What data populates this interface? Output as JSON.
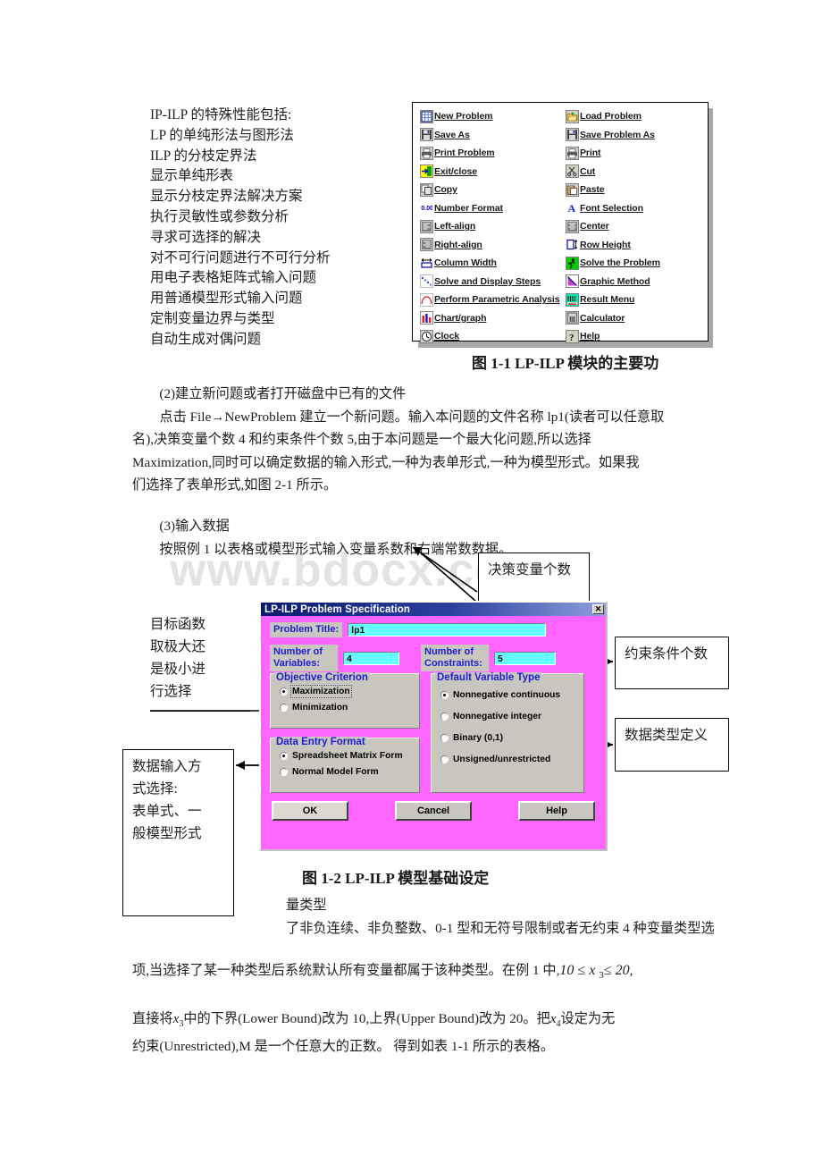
{
  "watermark": "www.bdocx.com",
  "feature_list": {
    "items": [
      "IP-ILP 的特殊性能包括:",
      "LP 的单纯形法与图形法",
      "ILP 的分枝定界法",
      "显示单纯形表",
      "显示分枝定界法解决方案",
      "执行灵敏性或参数分析",
      "寻求可选择的解决",
      "对不可行问题进行不可行分析",
      "用电子表格矩阵式输入问题",
      "用普通模型形式输入问题",
      "定制变量边界与类型",
      "自动生成对偶问题"
    ]
  },
  "toolbar": {
    "left_column": [
      {
        "icon": "new-problem-icon",
        "label": "New Problem"
      },
      {
        "icon": "save-icon",
        "label": "Save As"
      },
      {
        "icon": "printer-icon",
        "label": "Print Problem"
      },
      {
        "icon": "exit-door-icon",
        "label": "Exit/close"
      },
      {
        "icon": "copy-icon",
        "label": "Copy"
      },
      {
        "icon": "number-format-icon",
        "label": "Number Format"
      },
      {
        "icon": "left-align-icon",
        "label": "Left-align"
      },
      {
        "icon": "right-align-icon",
        "label": "Right-align"
      },
      {
        "icon": "column-width-icon",
        "label": "Column Width"
      },
      {
        "icon": "steps-icon",
        "label": "Solve and Display Steps"
      },
      {
        "icon": "parametric-curve-icon",
        "label": "Perform Parametric Analysis"
      },
      {
        "icon": "bar-chart-icon",
        "label": "Chart/graph"
      },
      {
        "icon": "clock-icon",
        "label": "Clock"
      }
    ],
    "right_column": [
      {
        "icon": "open-folder-icon",
        "label": "Load Problem"
      },
      {
        "icon": "save-icon",
        "label": "Save Problem As"
      },
      {
        "icon": "printer-icon",
        "label": "Print"
      },
      {
        "icon": "scissors-icon",
        "label": "Cut"
      },
      {
        "icon": "clipboard-paste-icon",
        "label": "Paste"
      },
      {
        "icon": "font-letter-a-icon",
        "label": "Font Selection"
      },
      {
        "icon": "center-align-icon",
        "label": "Center"
      },
      {
        "icon": "row-height-icon",
        "label": "Row Height"
      },
      {
        "icon": "runner-icon",
        "label": "Solve the Problem"
      },
      {
        "icon": "graph-curve-icon",
        "label": "Graphic Method"
      },
      {
        "icon": "result-grid-icon",
        "label": "Result Menu"
      },
      {
        "icon": "calculator-icon",
        "label": "Calculator"
      },
      {
        "icon": "help-question-icon",
        "label": "Help"
      }
    ]
  },
  "captions": {
    "fig_1_1": "图 1-1   LP-ILP 模块的主要功",
    "fig_1_2": "图 1-2   LP-ILP 模型基础设定"
  },
  "paragraphs": {
    "section2_heading": "(2)建立新问题或者打开磁盘中已有的文件",
    "section2_body_a": "点击 File→NewProblem 建立一个新问题。输入本问题的文件名称 lp1(读者可以任意取",
    "section2_body_b": "名),决策变量个数 4 和约束条件个数 5,由于本问题是一个最大化问题,所以选择",
    "section2_body_c": "Maximization,同时可以确定数据的输入形式,一种为表单形式,一种为模型形式。如果我",
    "section2_body_d": "们选择了表单形式,如图 2-1 所示。",
    "section3_heading": "(3)输入数据",
    "section3_body": "按照例 1 以表格或模型形式输入变量系数和右端常数数据。",
    "tail_a": "量类型",
    "tail_b": "了非负连续、非负整数、0-1 型和无符号限制或者无约束 4 种变量类型选",
    "tail_c1": "项,当选择了某一种类型后系统默认所有变量都属于该种类型。在例 1 中,",
    "tail_c2": ",",
    "tail_d1": "直接将",
    "tail_d2": "中的下界(Lower Bound)改为 10,上界(Upper Bound)改为 20。把",
    "tail_d3": "设定为无",
    "tail_e": "约束(Unrestricted),M 是一个任意大的正数。   得到如表 1-1 所示的表格。"
  },
  "math": {
    "bounds_expr": "10 ≤ x 3 ≤ 20",
    "x3": "x3",
    "x4": "x4"
  },
  "callouts": {
    "objective": [
      "目标函数",
      "取极大还",
      "是极小进",
      "行选择"
    ],
    "num_variables": "决策变量个数",
    "num_constraints": "约束条件个数",
    "data_type": "数据类型定义",
    "data_entry": [
      "数据输入方",
      "式选择:",
      "表单式、一",
      "般模型形式"
    ]
  },
  "dialog": {
    "title": "LP-ILP Problem Specification",
    "close_label": "✕",
    "problem_title_label": "Problem Title:",
    "problem_title_value": "lp1",
    "num_variables_label": [
      "Number of",
      "Variables:"
    ],
    "num_variables_value": "4",
    "num_constraints_label": [
      "Number of",
      "Constraints:"
    ],
    "num_constraints_value": "5",
    "objective_criterion": {
      "title": "Objective Criterion",
      "options": [
        "Maximization",
        "Minimization"
      ],
      "selected": "Maximization"
    },
    "default_variable_type": {
      "title": "Default Variable Type",
      "options": [
        "Nonnegative continuous",
        "Nonnegative integer",
        "Binary (0,1)",
        "Unsigned/unrestricted"
      ],
      "selected": "Nonnegative continuous"
    },
    "data_entry_format": {
      "title": "Data Entry Format",
      "options": [
        "Spreadsheet Matrix Form",
        "Normal Model Form"
      ],
      "selected": "Spreadsheet Matrix Form"
    },
    "buttons": [
      "OK",
      "Cancel",
      "Help"
    ]
  },
  "colors": {
    "dialog_background": "#ff66ff",
    "titlebar_start": "#0a1a6e",
    "groupbox_face": "#c9c6c0",
    "textbox_fill": "#66ffff",
    "label_text": "#2020cc"
  }
}
